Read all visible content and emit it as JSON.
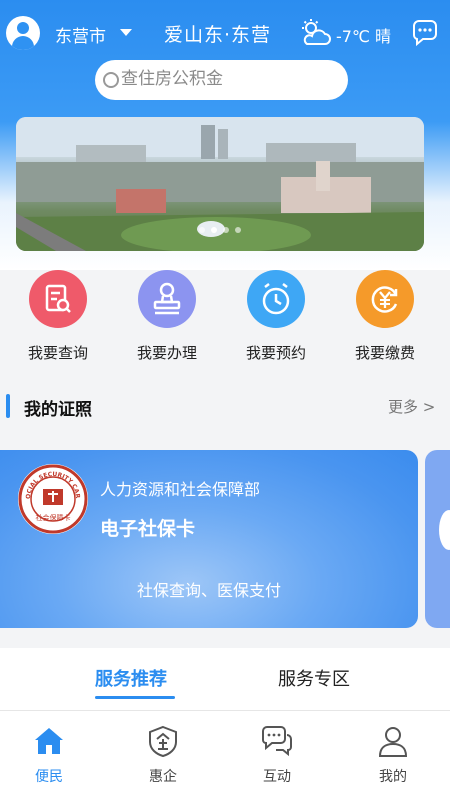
{
  "header": {
    "city": "东营市",
    "brand": "爱山东·东营",
    "weather": "-7℃ 晴",
    "weather_icon": "cloud-sun-icon"
  },
  "search": {
    "placeholder": "查住房公积金"
  },
  "banner": {
    "slide_count": 4,
    "active_slide": 2
  },
  "quick_actions": [
    {
      "label": "我要查询",
      "icon": "search-document-icon",
      "color": "#ef5a6a"
    },
    {
      "label": "我要办理",
      "icon": "stamp-icon",
      "color": "#8c94f0"
    },
    {
      "label": "我要预约",
      "icon": "alarm-clock-icon",
      "color": "#3ea7f5"
    },
    {
      "label": "我要缴费",
      "icon": "yuan-refresh-icon",
      "color": "#f59a2a"
    }
  ],
  "section": {
    "title": "我的证照",
    "more": "更多 >"
  },
  "card": {
    "department": "人力资源和社会保障部",
    "name": "电子社保卡",
    "description": "社保查询、医保支付",
    "seal_text_top": "SOCIAL SECURITY CARD",
    "seal_text_bottom": "社会保障卡"
  },
  "tabs": [
    {
      "label": "服务推荐",
      "active": true
    },
    {
      "label": "服务专区",
      "active": false
    }
  ],
  "bottom_nav": [
    {
      "label": "便民",
      "icon": "home-icon",
      "active": true
    },
    {
      "label": "惠企",
      "icon": "enterprise-shield-icon",
      "active": false
    },
    {
      "label": "互动",
      "icon": "chat-bubbles-icon",
      "active": false
    },
    {
      "label": "我的",
      "icon": "user-icon",
      "active": false
    }
  ],
  "colors": {
    "primary": "#2b8df0"
  }
}
